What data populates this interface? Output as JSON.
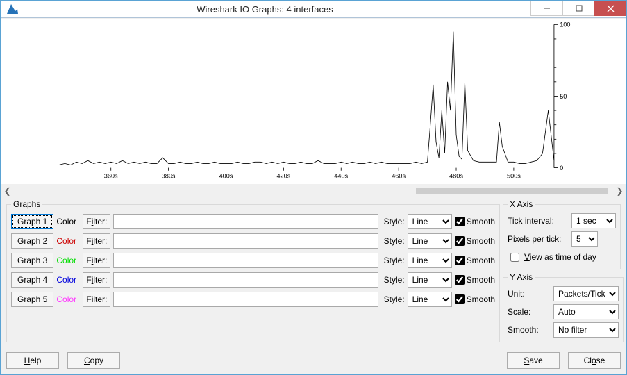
{
  "window_title": "Wireshark IO Graphs: 4 interfaces",
  "chart_data": {
    "type": "line",
    "xlabel": "",
    "ylabel": "",
    "title": "",
    "ylim": [
      0,
      100
    ],
    "xlim": [
      342,
      514
    ],
    "x_tick_labels": [
      "360s",
      "380s",
      "400s",
      "420s",
      "440s",
      "460s",
      "480s",
      "500s"
    ],
    "x_tick_values": [
      360,
      380,
      400,
      420,
      440,
      460,
      480,
      500
    ],
    "y_tick_labels": [
      "0",
      "50",
      "100"
    ],
    "y_tick_values": [
      0,
      50,
      100
    ],
    "series": [
      {
        "name": "Graph 1",
        "color": "#000000",
        "x": [
          342,
          344,
          346,
          348,
          350,
          352,
          354,
          356,
          358,
          360,
          362,
          364,
          366,
          368,
          370,
          372,
          374,
          376,
          378,
          380,
          382,
          384,
          386,
          388,
          390,
          392,
          394,
          396,
          398,
          400,
          402,
          404,
          406,
          408,
          410,
          412,
          414,
          416,
          418,
          420,
          422,
          424,
          426,
          428,
          430,
          432,
          434,
          436,
          438,
          440,
          442,
          444,
          446,
          448,
          450,
          452,
          454,
          456,
          458,
          460,
          462,
          464,
          466,
          468,
          470,
          471,
          472,
          473,
          474,
          475,
          476,
          477,
          478,
          479,
          480,
          481,
          482,
          483,
          484,
          486,
          488,
          490,
          492,
          494,
          495,
          496,
          498,
          500,
          502,
          504,
          506,
          508,
          510,
          512,
          514
        ],
        "y": [
          2,
          3,
          2,
          4,
          3,
          5,
          3,
          4,
          3,
          4,
          3,
          5,
          3,
          4,
          3,
          4,
          3,
          3,
          7,
          3,
          3,
          4,
          3,
          3,
          4,
          3,
          3,
          4,
          3,
          3,
          3,
          4,
          3,
          3,
          4,
          4,
          3,
          4,
          3,
          4,
          3,
          3,
          4,
          3,
          3,
          5,
          3,
          3,
          3,
          4,
          3,
          4,
          3,
          3,
          4,
          3,
          4,
          3,
          3,
          3,
          3,
          3,
          4,
          3,
          4,
          30,
          58,
          18,
          7,
          40,
          10,
          60,
          40,
          95,
          23,
          8,
          6,
          60,
          12,
          5,
          4,
          4,
          4,
          4,
          32,
          15,
          4,
          4,
          3,
          3,
          4,
          5,
          10,
          40,
          5
        ]
      }
    ]
  },
  "scrollbar": {
    "thumb_start_pct": 67,
    "thumb_width_pct": 32
  },
  "graphs_panel_title": "Graphs",
  "xaxis_panel_title": "X Axis",
  "yaxis_panel_title": "Y Axis",
  "graph_rows": [
    {
      "btn": "Graph 1",
      "color_label": "Color",
      "color": "#000000",
      "filter_btn": "Filter:",
      "filter_val": "",
      "style_label": "Style:",
      "style": "Line",
      "smooth_label": "Smooth",
      "checked": true,
      "focused": true
    },
    {
      "btn": "Graph 2",
      "color_label": "Color",
      "color": "#cc0000",
      "filter_btn": "Filter:",
      "filter_val": "",
      "style_label": "Style:",
      "style": "Line",
      "smooth_label": "Smooth",
      "checked": true,
      "focused": false
    },
    {
      "btn": "Graph 3",
      "color_label": "Color",
      "color": "#00dd00",
      "filter_btn": "Filter:",
      "filter_val": "",
      "style_label": "Style:",
      "style": "Line",
      "smooth_label": "Smooth",
      "checked": true,
      "focused": false
    },
    {
      "btn": "Graph 4",
      "color_label": "Color",
      "color": "#0000dd",
      "filter_btn": "Filter:",
      "filter_val": "",
      "style_label": "Style:",
      "style": "Line",
      "smooth_label": "Smooth",
      "checked": true,
      "focused": false
    },
    {
      "btn": "Graph 5",
      "color_label": "Color",
      "color": "#ff33ff",
      "filter_btn": "Filter:",
      "filter_val": "",
      "style_label": "Style:",
      "style": "Line",
      "smooth_label": "Smooth",
      "checked": true,
      "focused": false
    }
  ],
  "xaxis": {
    "tick_interval_label": "Tick interval:",
    "tick_interval": "1 sec",
    "pixels_label": "Pixels per tick:",
    "pixels": "5",
    "view_time_label": "View as time of day",
    "view_time_checked": false
  },
  "yaxis": {
    "unit_label": "Unit:",
    "unit": "Packets/Tick",
    "scale_label": "Scale:",
    "scale": "Auto",
    "smooth_label": "Smooth:",
    "smooth": "No filter"
  },
  "buttons": {
    "help": "Help",
    "copy": "Copy",
    "save": "Save",
    "close": "Close"
  }
}
